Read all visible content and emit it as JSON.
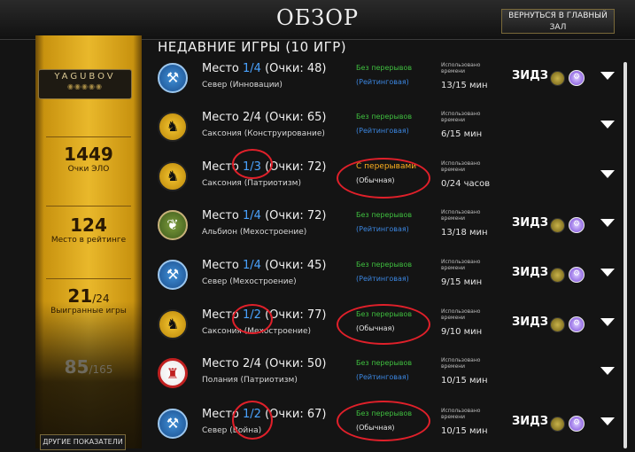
{
  "header": {
    "title": "ОБЗОР",
    "back_label": "ВЕРНУТЬСЯ В ГЛАВНЫЙ ЗАЛ"
  },
  "profile": {
    "name": "YAGUBOV",
    "elo_value": "1449",
    "elo_label": "Очки ЭЛО",
    "rank_value": "124",
    "rank_label": "Место в рейтинге",
    "wins_value": "21",
    "wins_total": "/24",
    "wins_label": "Выигранные игры",
    "last_value": "85",
    "last_total": "/165",
    "more_label": "ДРУГИЕ ПОКАЗАТЕЛИ"
  },
  "section_title": "НЕДАВНИЕ ИГРЫ (10 ИГР)",
  "games": [
    {
      "emblem": "hammer-icon",
      "place_prefix": "Место",
      "place": "1/4",
      "place_highlight": true,
      "score": "(Очки: 48)",
      "region": "Север (Инновации)",
      "mode": "Без перерывов",
      "type": "(Рейтинговая)",
      "used_label": "Использовано времени",
      "time": "13/15 мин",
      "opponent": "ЗИДЗ"
    },
    {
      "emblem": "horse-icon",
      "place_prefix": "Место",
      "place": "2/4",
      "place_highlight": false,
      "score": "(Очки: 65)",
      "region": "Саксония (Конструирование)",
      "mode": "Без перерывов",
      "type": "(Рейтинговая)",
      "used_label": "Использовано времени",
      "time": "6/15 мин",
      "opponent": ""
    },
    {
      "emblem": "horse-icon",
      "place_prefix": "Место",
      "place": "1/3",
      "place_highlight": true,
      "score": "(Очки: 72)",
      "region": "Саксония (Патриотизм)",
      "mode": "С перерывами",
      "type": "(Обычная)",
      "used_label": "Использовано времени",
      "time": "0/24 часов",
      "opponent": ""
    },
    {
      "emblem": "bear-icon",
      "place_prefix": "Место",
      "place": "1/4",
      "place_highlight": true,
      "score": "(Очки: 72)",
      "region": "Альбион (Мехостроение)",
      "mode": "Без перерывов",
      "type": "(Рейтинговая)",
      "used_label": "Использовано времени",
      "time": "13/18 мин",
      "opponent": "ЗИДЗ"
    },
    {
      "emblem": "hammer-icon",
      "place_prefix": "Место",
      "place": "1/4",
      "place_highlight": true,
      "score": "(Очки: 45)",
      "region": "Север (Мехостроение)",
      "mode": "Без перерывов",
      "type": "(Рейтинговая)",
      "used_label": "Использовано времени",
      "time": "9/15 мин",
      "opponent": "ЗИДЗ"
    },
    {
      "emblem": "horse-icon",
      "place_prefix": "Место",
      "place": "1/2",
      "place_highlight": true,
      "score": "(Очки: 77)",
      "region": "Саксония (Мехостроение)",
      "mode": "Без перерывов",
      "type": "(Обычная)",
      "used_label": "Использовано времени",
      "time": "9/10 мин",
      "opponent": "ЗИДЗ"
    },
    {
      "emblem": "bear-red-icon",
      "place_prefix": "Место",
      "place": "2/4",
      "place_highlight": false,
      "score": "(Очки: 50)",
      "region": "Полания (Патриотизм)",
      "mode": "Без перерывов",
      "type": "(Рейтинговая)",
      "used_label": "Использовано времени",
      "time": "10/15 мин",
      "opponent": ""
    },
    {
      "emblem": "hammer-icon",
      "place_prefix": "Место",
      "place": "1/2",
      "place_highlight": true,
      "score": "(Очки: 67)",
      "region": "Север (Война)",
      "mode": "Без перерывов",
      "type": "(Обычная)",
      "used_label": "Использовано времени",
      "time": "10/15 мин",
      "opponent": "ЗИДЗ"
    }
  ],
  "colors": {
    "accent_gold": "#e9b82b",
    "highlight_blue": "#4aa3ff",
    "mode_green": "#3fbf3f",
    "mode_orange": "#ffb01f",
    "rating_blue": "#3b86e0",
    "annotation_red": "#e0202a"
  }
}
